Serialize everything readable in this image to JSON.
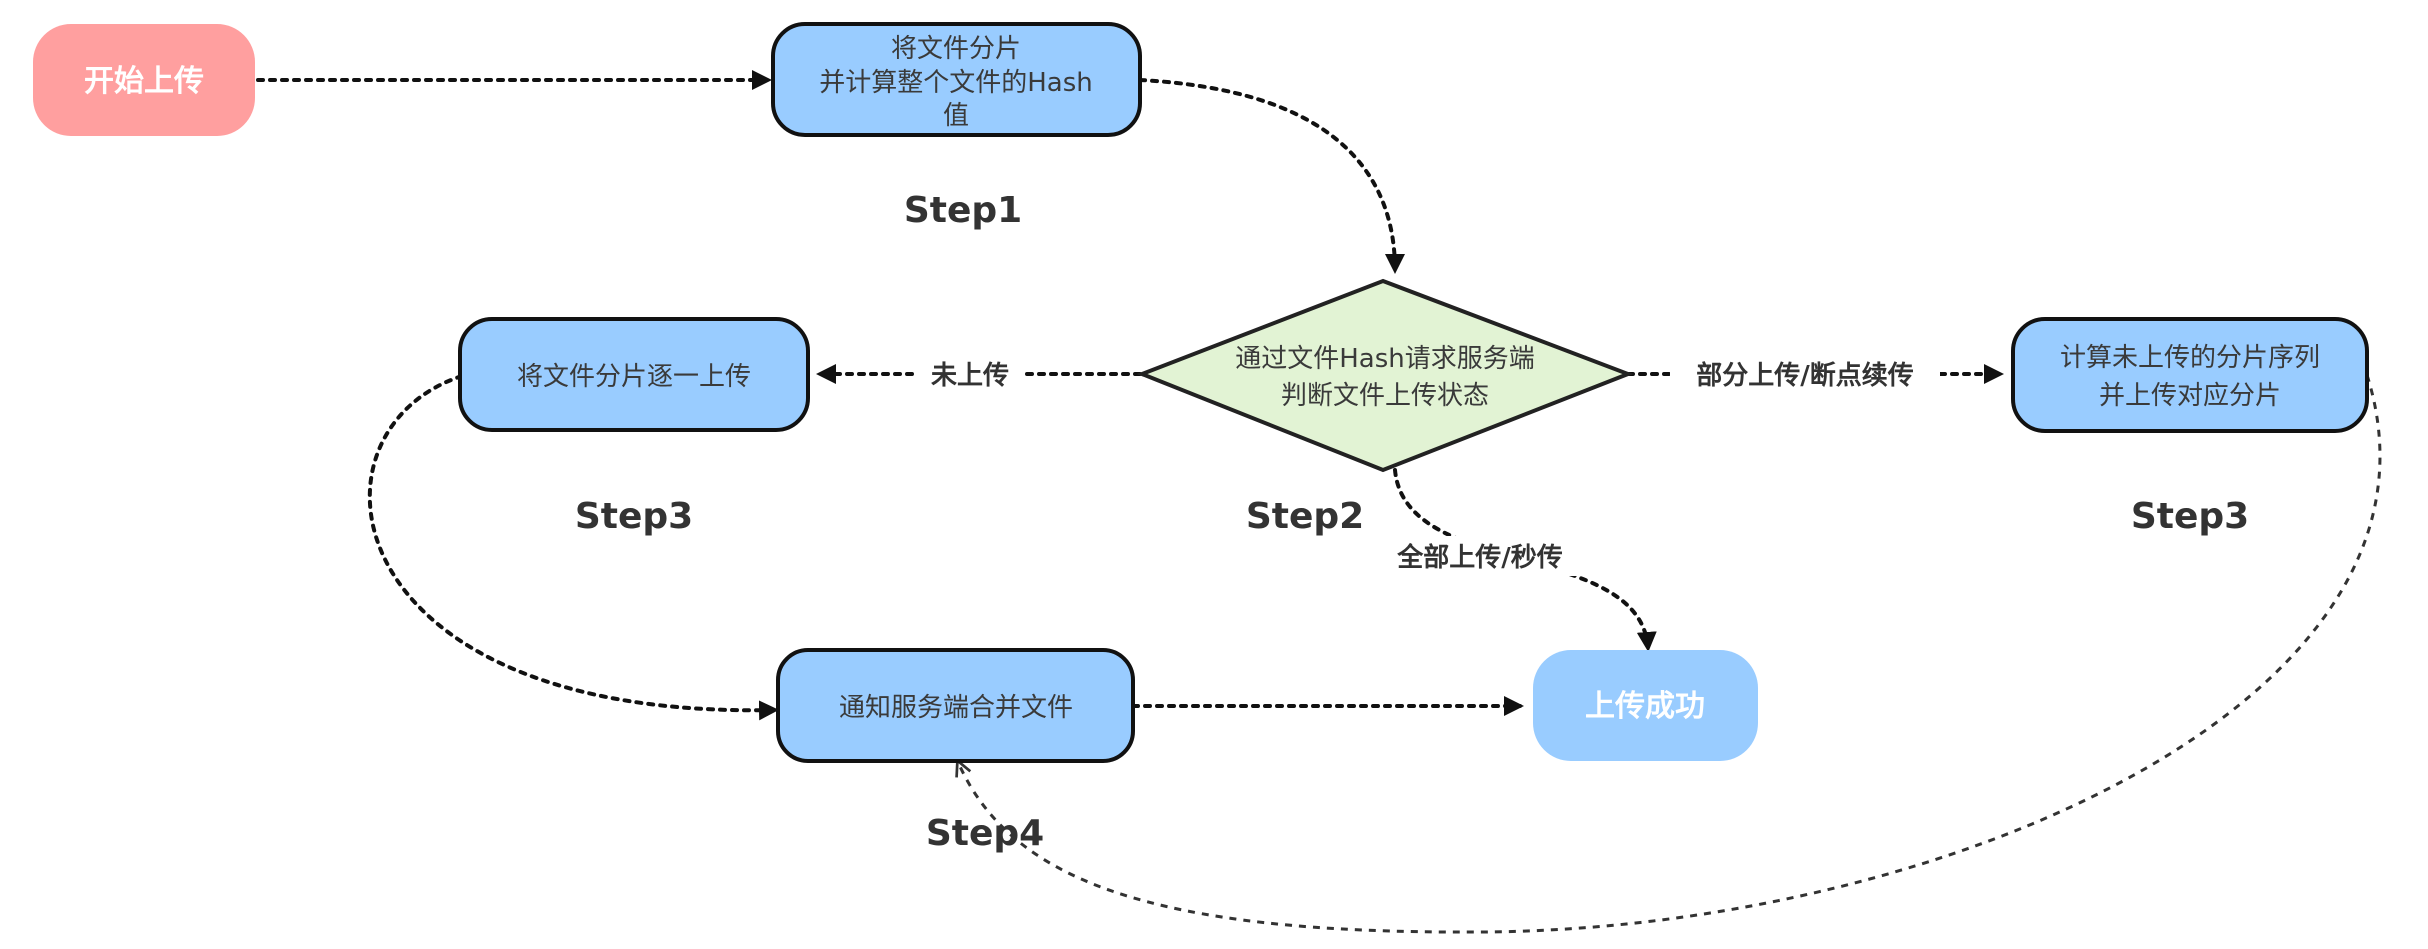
{
  "colors": {
    "start_fill": "#ff9f9f",
    "process_fill": "#99ccff",
    "process_stroke": "#111111",
    "decision_fill": "#e2f3d4",
    "decision_stroke": "#222222",
    "end_fill": "#99ccff"
  },
  "nodes": {
    "start": {
      "label": "开始上传"
    },
    "slice_hash": {
      "lines": [
        "将文件分片",
        "并计算整个文件的Hash",
        "值"
      ]
    },
    "decision": {
      "lines": [
        "通过文件Hash请求服务端",
        "判断文件上传状态"
      ]
    },
    "upload_all": {
      "label": "将文件分片逐一上传"
    },
    "upload_missing": {
      "lines": [
        "计算未上传的分片序列",
        "并上传对应分片"
      ]
    },
    "merge": {
      "label": "通知服务端合并文件"
    },
    "success": {
      "label": "上传成功"
    }
  },
  "steps": {
    "step1": "Step1",
    "step2": "Step2",
    "step3_left": "Step3",
    "step3_right": "Step3",
    "step4": "Step4"
  },
  "edge_labels": {
    "not_uploaded": "未上传",
    "partial": "部分上传/断点续传",
    "full": "全部上传/秒传"
  }
}
